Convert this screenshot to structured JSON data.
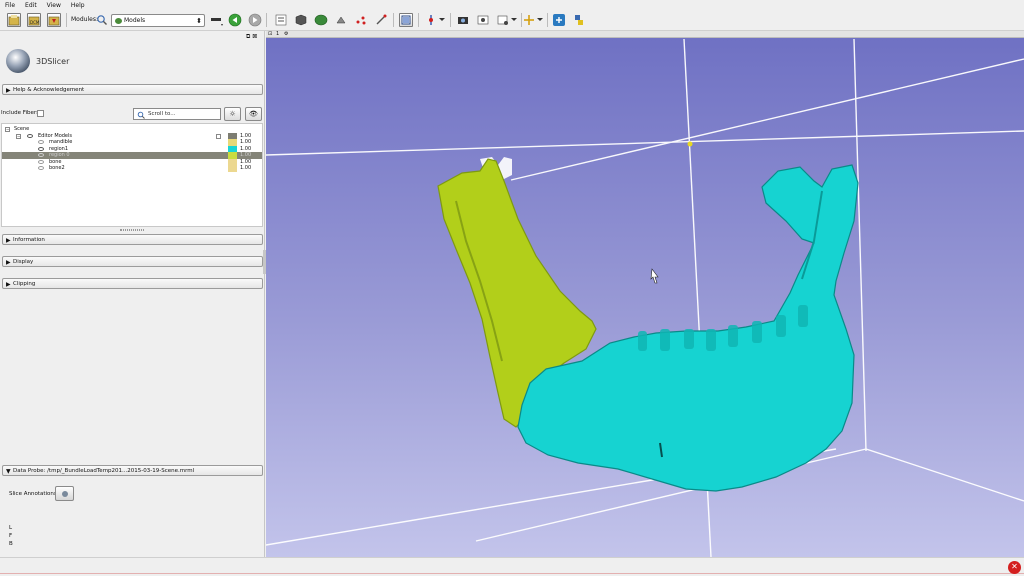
{
  "menu": [
    "File",
    "Edit",
    "View",
    "Help"
  ],
  "toolbar": {
    "modules_label": "Modules:",
    "module_selected": "Models"
  },
  "panel": {
    "app_name": "3DSlicer",
    "help_section": "Help & Acknowledgement",
    "include_fibers_label": "Include Fibers",
    "scroll_placeholder": "Scroll to...",
    "tree": [
      {
        "label": "Scene",
        "opacity": "1.00",
        "color": "",
        "indent": 12
      },
      {
        "label": "Editor Models",
        "opacity": "1.00",
        "color": "#7d7d72",
        "indent": 36
      },
      {
        "label": "mandible",
        "opacity": "1.00",
        "color": "#e8d878",
        "indent": 47
      },
      {
        "label": "region1",
        "opacity": "1.00",
        "color": "#19d4d6",
        "indent": 47
      },
      {
        "label": "region 0",
        "opacity": "1.00",
        "color": "#c8dc40",
        "indent": 47
      },
      {
        "label": "bone",
        "opacity": "1.00",
        "color": "#ecd890",
        "indent": 47
      },
      {
        "label": "bone2",
        "opacity": "1.00",
        "color": "#ecd890",
        "indent": 47
      }
    ],
    "sections": [
      "Information",
      "Display",
      "Clipping"
    ],
    "data_probe": "Data Probe: /tmp/_BundleLoadTemp201...2015-03-19-Scene.mrml",
    "slice_annotations_label": "Slice Annotations:",
    "probe_letters": [
      "L",
      "F",
      "B"
    ]
  },
  "view": {
    "tab_label": "1",
    "bone_colors": {
      "left_ramus": "#b8d41e",
      "mandible_body": "#16d3d1"
    }
  },
  "icons": [
    "load-data-icon",
    "load-dicom-icon",
    "save-icon",
    "search-icon",
    "back-icon",
    "forward-icon",
    "layout-icon",
    "python-icon",
    "error-icon"
  ]
}
